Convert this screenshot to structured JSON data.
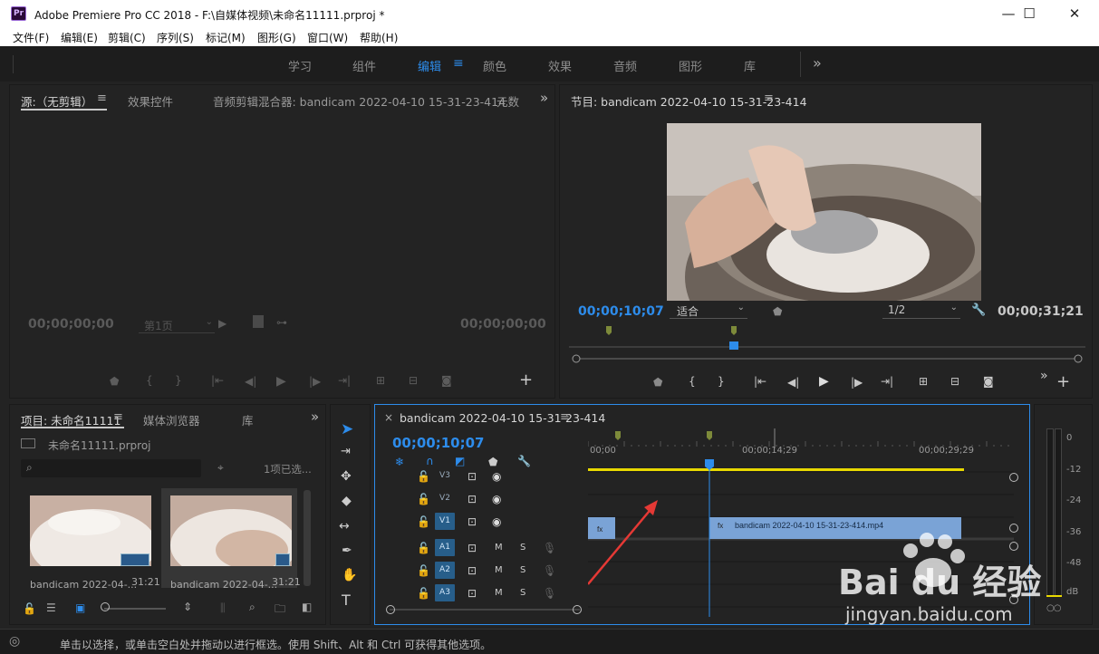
{
  "titlebar": {
    "title": "Adobe Premiere Pro CC 2018 - F:\\自媒体视频\\未命名11111.prproj *",
    "logo": "Pr",
    "minimize": "—",
    "maximize": "☐",
    "close": "✕"
  },
  "menu": [
    "文件(F)",
    "编辑(E)",
    "剪辑(C)",
    "序列(S)",
    "标记(M)",
    "图形(G)",
    "窗口(W)",
    "帮助(H)"
  ],
  "workspaces": {
    "items": [
      "学习",
      "组件",
      "编辑",
      "颜色",
      "效果",
      "音频",
      "图形",
      "库"
    ],
    "active_index": 2,
    "more": "»"
  },
  "source_panel": {
    "tabs": [
      "源:（无剪辑）",
      "效果控件",
      "音频剪辑混合器: bandicam 2022-04-10 15-31-23-414",
      "元数"
    ],
    "menu_icon": "≡",
    "more": "»",
    "tc_left": "00;00;00;00",
    "tc_right": "00;00;00;00",
    "page_select": "第1页",
    "add": "+"
  },
  "program_panel": {
    "tab": "节目: bandicam 2022-04-10 15-31-23-414",
    "menu_icon": "≡",
    "tc_current": "00;00;10;07",
    "fit": "适合",
    "resolution": "1/2",
    "tc_duration": "00;00;31;21",
    "add": "+",
    "more": "»"
  },
  "project_panel": {
    "tabs": [
      "项目: 未命名11111",
      "媒体浏览器",
      "库"
    ],
    "menu_icon": "≡",
    "more": "»",
    "file": "未命名11111.prproj",
    "search_placeholder": "",
    "selection": "1项已选...",
    "items": [
      {
        "name": "bandicam 2022-04-...",
        "duration": "31:21"
      },
      {
        "name": "bandicam 2022-04-...",
        "duration": "31:21"
      }
    ]
  },
  "timeline": {
    "close": "×",
    "title": "bandicam 2022-04-10 15-31-23-414",
    "menu_icon": "≡",
    "tc": "00;00;10;07",
    "ruler": [
      "00;00",
      "00;00;14;29",
      "00;00;29;29"
    ],
    "tracks": [
      {
        "id": "V3",
        "targeted": false,
        "type": "video"
      },
      {
        "id": "V2",
        "targeted": false,
        "type": "video"
      },
      {
        "id": "V1",
        "targeted": true,
        "type": "video"
      },
      {
        "id": "A1",
        "targeted": true,
        "type": "audio"
      },
      {
        "id": "A2",
        "targeted": true,
        "type": "audio"
      },
      {
        "id": "A3",
        "targeted": true,
        "type": "audio"
      }
    ],
    "mute": "M",
    "solo": "S",
    "clip_label": "bandicam 2022-04-10 15-31-23-414.mp4",
    "clip_fx": "fx",
    "playhead_fraction": 0.32,
    "annotation_color": "#e53935"
  },
  "audio_meter": {
    "labels": [
      "0",
      "-12",
      "-24",
      "-36",
      "-48",
      "dB"
    ],
    "solo": "○○"
  },
  "tools": [
    "selection-tool",
    "track-select-tool",
    "ripple-edit-tool",
    "razor-tool",
    "slip-tool",
    "pen-tool",
    "hand-tool",
    "type-tool"
  ],
  "status": "单击以选择，或单击空白处并拖动以进行框选。使用 Shift、Alt 和 Ctrl 可获得其他选项。",
  "watermark": {
    "brand": "Bai du 经验",
    "url": "jingyan.baidu.com"
  },
  "colors": {
    "accent": "#2d8ceb",
    "panel": "#232323",
    "track_target": "#275e8a",
    "clip": "#7aa3d6",
    "marker": "#7d8a3a",
    "yellow": "#e8d800"
  }
}
